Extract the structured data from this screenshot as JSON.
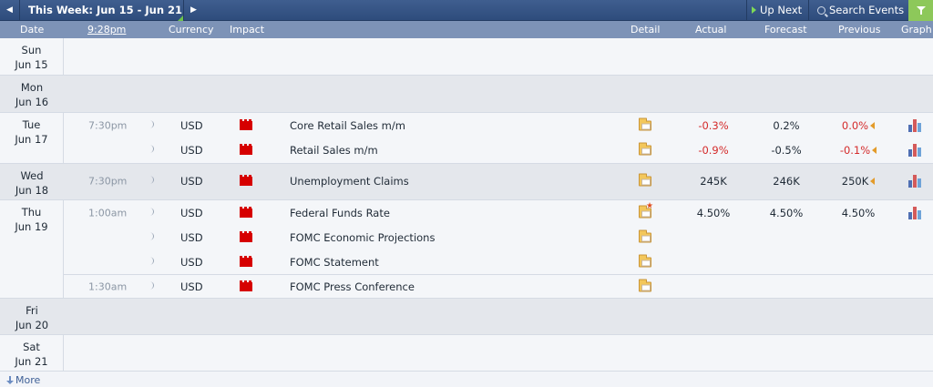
{
  "topbar": {
    "week_label": "This Week: Jun 15 - Jun 21",
    "prev_icon": "triangle-left",
    "next_icon": "triangle-right",
    "up_next_label": "Up Next",
    "search_label": "Search Events",
    "filter_icon": "funnel-icon",
    "accent_green": "#8dc85a",
    "bar_color": "#2e4c7c"
  },
  "columns": {
    "date": "Date",
    "time": "9:28pm",
    "currency": "Currency",
    "impact": "Impact",
    "detail": "Detail",
    "actual": "Actual",
    "forecast": "Forecast",
    "previous": "Previous",
    "graph": "Graph"
  },
  "days": [
    {
      "weekday": "Sun",
      "date": "Jun 15",
      "events": []
    },
    {
      "weekday": "Mon",
      "date": "Jun 16",
      "events": []
    },
    {
      "weekday": "Tue",
      "date": "Jun 17",
      "events": [
        {
          "time": "7:30pm",
          "currency": "USD",
          "impact": "high",
          "title": "Core Retail Sales m/m",
          "actual": "-0.3%",
          "forecast": "0.2%",
          "previous": "0.0%"
        },
        {
          "time": "",
          "currency": "USD",
          "impact": "high",
          "title": "Retail Sales m/m",
          "actual": "-0.9%",
          "forecast": "-0.5%",
          "previous": "-0.1%"
        }
      ]
    },
    {
      "weekday": "Wed",
      "date": "Jun 18",
      "events": [
        {
          "time": "7:30pm",
          "currency": "USD",
          "impact": "high",
          "title": "Unemployment Claims",
          "actual": "245K",
          "forecast": "246K",
          "previous": "250K"
        }
      ]
    },
    {
      "weekday": "Thu",
      "date": "Jun 19",
      "events": [
        {
          "time": "1:00am",
          "currency": "USD",
          "impact": "high",
          "title": "Federal Funds Rate",
          "actual": "4.50%",
          "forecast": "4.50%",
          "previous": "4.50%"
        },
        {
          "time": "",
          "currency": "USD",
          "impact": "high",
          "title": "FOMC Economic Projections",
          "actual": "",
          "forecast": "",
          "previous": ""
        },
        {
          "time": "",
          "currency": "USD",
          "impact": "high",
          "title": "FOMC Statement",
          "actual": "",
          "forecast": "",
          "previous": ""
        },
        {
          "time": "1:30am",
          "currency": "USD",
          "impact": "high",
          "title": "FOMC Press Conference",
          "actual": "",
          "forecast": "",
          "previous": ""
        }
      ]
    },
    {
      "weekday": "Fri",
      "date": "Jun 20",
      "events": []
    },
    {
      "weekday": "Sat",
      "date": "Jun 21",
      "events": []
    }
  ],
  "footer": {
    "more_label": "More"
  },
  "colors": {
    "impact_high": "#d60000",
    "actual_worse": "#d42a2a",
    "revision_arrow": "#e39b2a"
  }
}
